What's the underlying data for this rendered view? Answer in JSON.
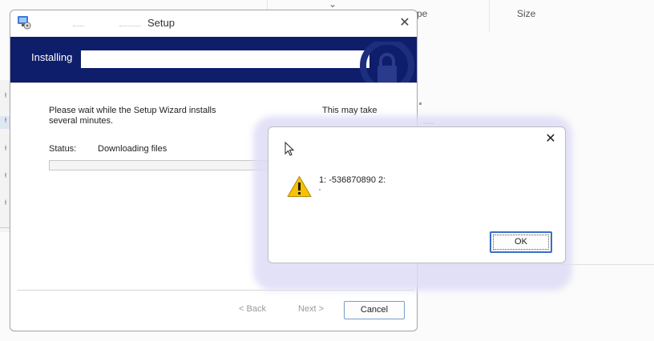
{
  "background_window": {
    "column_type": "pe",
    "column_size": "Size",
    "chevron_glyph": "⌄",
    "pin_glyph": "📌"
  },
  "setup_window": {
    "title": "Setup",
    "close_glyph": "✕",
    "banner_text": "Installing",
    "message": "Please wait while the Setup Wizard installs",
    "message_line2": "several minutes.",
    "message_extra": "This may take",
    "status_label": "Status:",
    "status_value": "Downloading files",
    "progress_fraction": 0.0,
    "back_button": "< Back",
    "next_button": "Next >",
    "cancel_button": "Cancel"
  },
  "error_dialog": {
    "close_glyph": "✕",
    "message": "1: -536870890 2:",
    "ok_button": "OK",
    "icon": "warning-icon"
  },
  "colors": {
    "banner_bg": "#0e1e6a",
    "accent_blue": "#3a6fc4",
    "warning_yellow": "#f7c200"
  }
}
